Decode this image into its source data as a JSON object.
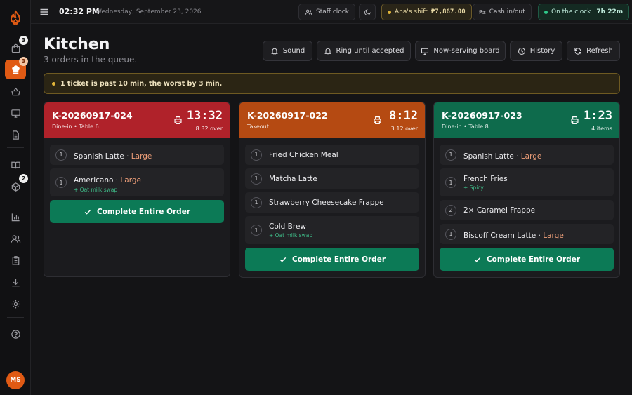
{
  "topbar": {
    "time": "02:32 PM",
    "date": "Wednesday, September 23, 2026",
    "staff_clock": "Staff clock",
    "shift_label": "Ana's shift",
    "shift_amount": "₱7,867.00",
    "cash_in_out": "Cash in/out",
    "on_clock_label": "On the clock",
    "on_clock_duration": "7h 22m"
  },
  "sidebar": {
    "orders_badge": "3",
    "kitchen_badge": "3",
    "inventory_badge": "2",
    "avatar_initials": "MS"
  },
  "header": {
    "title": "Kitchen",
    "subtitle": "3 orders in the queue.",
    "buttons": {
      "sound": "Sound",
      "ring": "Ring until accepted",
      "now_serving": "Now-serving board",
      "history": "History",
      "refresh": "Refresh"
    }
  },
  "alert": {
    "text": "1 ticket is past 10 min, the worst by 3 min."
  },
  "complete_label": "Complete Entire Order",
  "tickets": [
    {
      "id": "K-20260917-024",
      "meta": "Dine-in • Table 6",
      "timer": "13:32",
      "status": "8:32 over",
      "color": "#b0222a",
      "items": [
        {
          "qty": "1",
          "name": "Spanish Latte",
          "size": "Large",
          "mod": ""
        },
        {
          "qty": "1",
          "name": "Americano",
          "size": "Large",
          "mod": "+ Oat milk swap"
        }
      ]
    },
    {
      "id": "K-20260917-022",
      "meta": "Takeout",
      "timer": "8:12",
      "status": "3:12 over",
      "color": "#b54a12",
      "items": [
        {
          "qty": "1",
          "name": "Fried Chicken Meal",
          "size": "",
          "mod": ""
        },
        {
          "qty": "1",
          "name": "Matcha Latte",
          "size": "",
          "mod": ""
        },
        {
          "qty": "1",
          "name": "Strawberry Cheesecake Frappe",
          "size": "",
          "mod": ""
        },
        {
          "qty": "1",
          "name": "Cold Brew",
          "size": "",
          "mod": "+ Oat milk swap"
        }
      ]
    },
    {
      "id": "K-20260917-023",
      "meta": "Dine-in • Table 8",
      "timer": "1:23",
      "status": "4 items",
      "color": "#0e6b4c",
      "items": [
        {
          "qty": "1",
          "name": "Spanish Latte",
          "size": "Large",
          "mod": ""
        },
        {
          "qty": "1",
          "name": "French Fries",
          "size": "",
          "mod": "+ Spicy"
        },
        {
          "qty": "2",
          "name": "2× Caramel Frappe",
          "size": "",
          "mod": ""
        },
        {
          "qty": "1",
          "name": "Biscoff Cream Latte",
          "size": "Large",
          "mod": ""
        }
      ]
    }
  ]
}
